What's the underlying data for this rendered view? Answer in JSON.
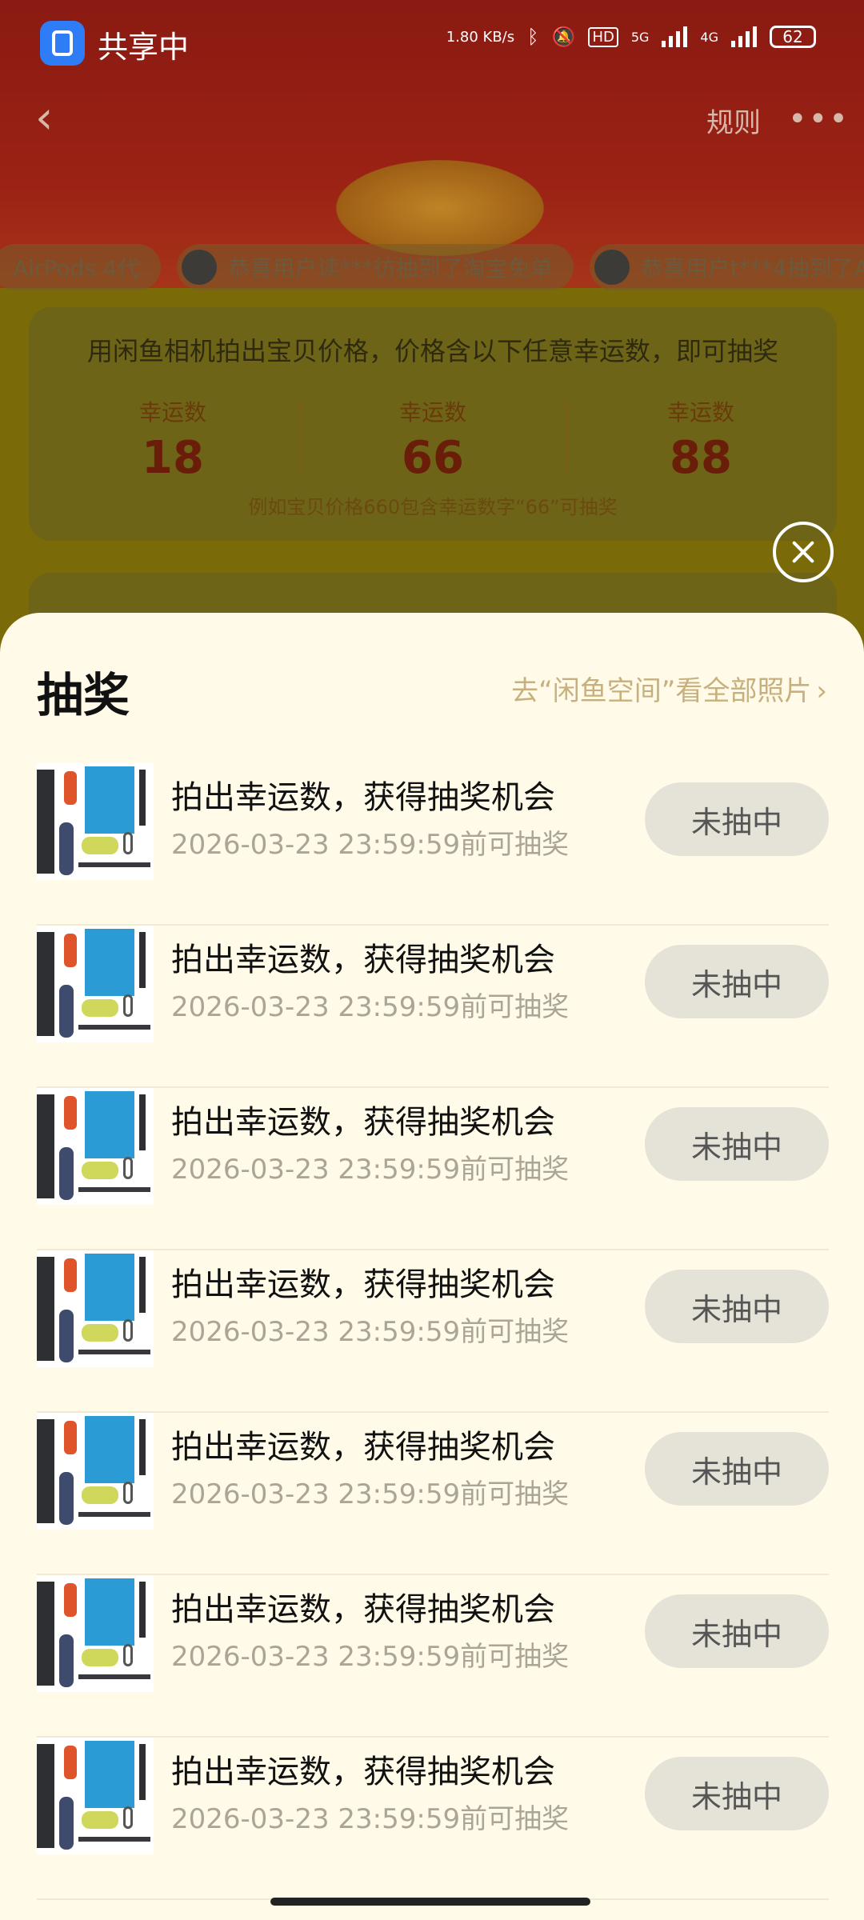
{
  "status_bar": {
    "share_text": "共享中",
    "net_speed": "1.80 KB/s",
    "sig1": "5G",
    "sig2": "4G",
    "hd": "HD",
    "battery": "62"
  },
  "nav": {
    "rules_label": "规则"
  },
  "ticker": [
    "AirPods 4代",
    "恭喜用户读***彷抽到了淘宝免单",
    "恭喜用户t***4抽到了A"
  ],
  "rule_card": {
    "title": "用闲鱼相机拍出宝贝价格，价格含以下任意幸运数，即可抽奖",
    "lucky": [
      {
        "label": "幸运数",
        "number": "18"
      },
      {
        "label": "幸运数",
        "number": "66"
      },
      {
        "label": "幸运数",
        "number": "88"
      }
    ],
    "hint": "例如宝贝价格660包含幸运数字“66”可抽奖"
  },
  "sheet": {
    "title": "抽奖",
    "link": "去“闲鱼空间”看全部照片",
    "items": [
      {
        "title": "拍出幸运数，获得抽奖机会",
        "subtitle": "2026-03-23 23:59:59前可抽奖",
        "status": "未抽中"
      },
      {
        "title": "拍出幸运数，获得抽奖机会",
        "subtitle": "2026-03-23 23:59:59前可抽奖",
        "status": "未抽中"
      },
      {
        "title": "拍出幸运数，获得抽奖机会",
        "subtitle": "2026-03-23 23:59:59前可抽奖",
        "status": "未抽中"
      },
      {
        "title": "拍出幸运数，获得抽奖机会",
        "subtitle": "2026-03-23 23:59:59前可抽奖",
        "status": "未抽中"
      },
      {
        "title": "拍出幸运数，获得抽奖机会",
        "subtitle": "2026-03-23 23:59:59前可抽奖",
        "status": "未抽中"
      },
      {
        "title": "拍出幸运数，获得抽奖机会",
        "subtitle": "2026-03-23 23:59:59前可抽奖",
        "status": "未抽中"
      },
      {
        "title": "拍出幸运数，获得抽奖机会",
        "subtitle": "2026-03-23 23:59:59前可抽奖",
        "status": "未抽中"
      }
    ]
  }
}
